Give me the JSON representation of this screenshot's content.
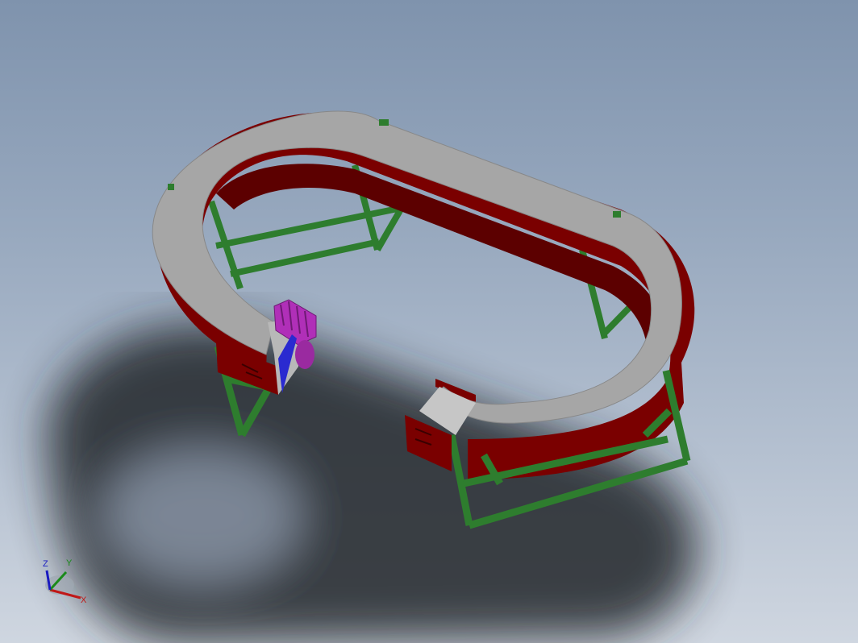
{
  "view": {
    "background_top": "#7f93ad",
    "background_bottom": "#cfd6e0"
  },
  "model": {
    "belt_color": "#a6a6a6",
    "guard_color": "#7a0000",
    "frame_color": "#2e7d2e",
    "motor_color": "#b02fb8",
    "drive_color": "#2a2ad0"
  },
  "triad": {
    "x_label": "X",
    "y_label": "Y",
    "z_label": "Z",
    "x_color": "#c01818",
    "y_color": "#1a8a1a",
    "z_color": "#1a1ac0"
  }
}
